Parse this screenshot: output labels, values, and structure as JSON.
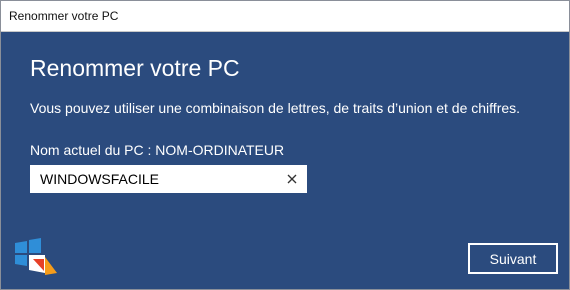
{
  "window": {
    "title": "Renommer votre PC"
  },
  "content": {
    "heading": "Renommer votre PC",
    "description": "Vous pouvez utiliser une combinaison de lettres, de traits d’union et de chiffres.",
    "current_name": "Nom actuel du PC : NOM-ORDINATEUR"
  },
  "name_field": {
    "value": "WINDOWSFACILE",
    "clear_icon": "close-icon"
  },
  "footer": {
    "next_label": "Suivant",
    "logo_icon": "windows-facile-logo"
  },
  "colors": {
    "background": "#2b4b7e",
    "text": "#ffffff",
    "titlebar": "#ffffff"
  }
}
